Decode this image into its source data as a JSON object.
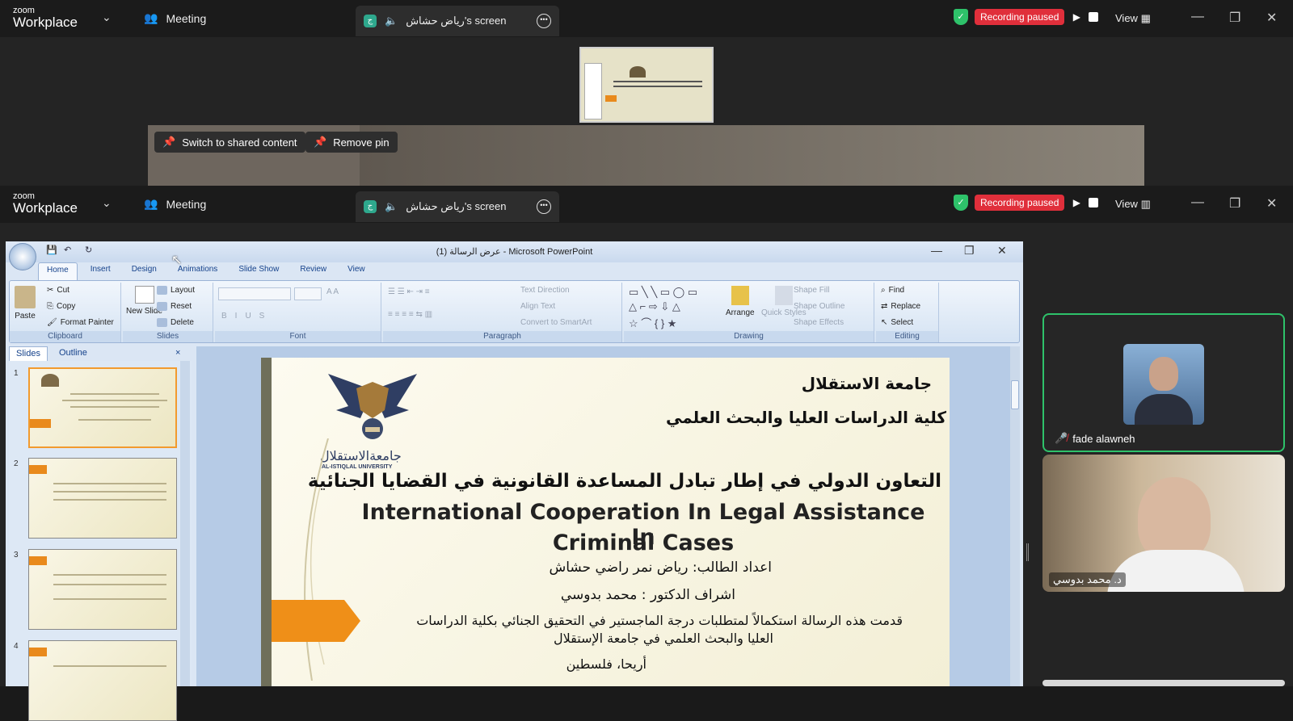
{
  "zoom": {
    "logo_line1": "zoom",
    "logo_line2": "Workplace",
    "meeting_label": "Meeting",
    "screen_tab_label": "رياض حشاش's screen",
    "recording_label": "Recording paused",
    "view_label": "View",
    "icons": [
      "chevron-down-icon",
      "people-icon",
      "speaker-icon",
      "more-icon",
      "shield-check-icon",
      "play-icon",
      "stop-icon",
      "minimize-icon",
      "restore-icon",
      "close-icon"
    ],
    "colors": {
      "recording": "#e02f3b",
      "shield": "#2ec26a",
      "active_speaker": "#2ec26a"
    }
  },
  "pin_controls": {
    "switch_label": "Switch to shared content",
    "remove_label": "Remove pin"
  },
  "powerpoint": {
    "window_title": "عرض الرسالة (1) - Microsoft PowerPoint",
    "tabs": [
      "Home",
      "Insert",
      "Design",
      "Animations",
      "Slide Show",
      "Review",
      "View"
    ],
    "clipboard": {
      "paste": "Paste",
      "cut": "Cut",
      "copy": "Copy",
      "format_painter": "Format Painter",
      "group": "Clipboard"
    },
    "slides_group": {
      "new_slide": "New Slide",
      "layout": "Layout",
      "reset": "Reset",
      "delete": "Delete",
      "group": "Slides"
    },
    "font_group": "Font",
    "paragraph": {
      "text_direction": "Text Direction",
      "align_text": "Align Text",
      "smartart": "Convert to SmartArt",
      "group": "Paragraph"
    },
    "drawing": {
      "arrange": "Arrange",
      "quick_styles": "Quick Styles",
      "shape_fill": "Shape Fill",
      "shape_outline": "Shape Outline",
      "shape_effects": "Shape Effects",
      "group": "Drawing"
    },
    "editing": {
      "find": "Find",
      "replace": "Replace",
      "select": "Select",
      "group": "Editing"
    },
    "panel_tabs": {
      "slides": "Slides",
      "outline": "Outline"
    },
    "slide_numbers": [
      "1",
      "2",
      "3",
      "4"
    ]
  },
  "slide": {
    "university": "جامعة الاستقلال",
    "college": "كلية الدراسات العليا والبحث العلمي",
    "logo_ar": "جامعةالاستقلال",
    "logo_en": "AL-ISTIQLAL UNIVERSITY",
    "title_ar": "التعاون الدولي في إطار تبادل المساعدة القانونية في القضايا الجنائية",
    "title_en_1": "International Cooperation In Legal Assistance In",
    "title_en_2": "Criminal Cases",
    "student": "اعداد الطالب: رياض نمر راضي حشاش",
    "supervisor": "اشراف الدكتور : محمد بدوسي",
    "statement_1": "قدمت هذه الرسالة استكمالاً لمتطلبات درجة الماجستير في التحقيق الجنائي بكلية الدراسات",
    "statement_2": "العليا والبحث العلمي في جامعة الإستقلال",
    "place": "أريحا، فلسطين"
  },
  "participants": [
    {
      "name": "fade alawneh",
      "muted": true,
      "active": true
    },
    {
      "name": "د. محمد بدوسي",
      "muted": false,
      "active": false
    }
  ]
}
